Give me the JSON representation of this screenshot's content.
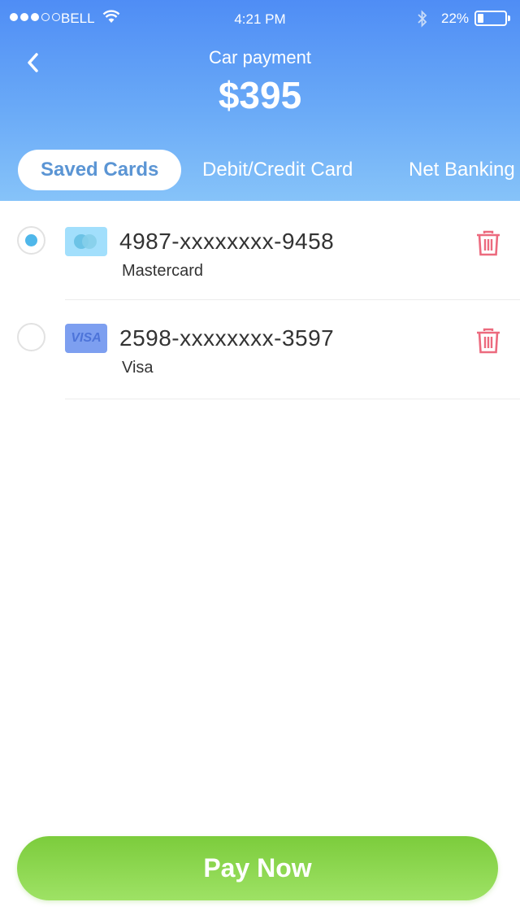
{
  "status_bar": {
    "carrier": "BELL",
    "time": "4:21 PM",
    "battery_percent": "22%",
    "battery_level": 0.22,
    "signal_bars_filled": 3,
    "signal_bars_total": 5
  },
  "header": {
    "title": "Car payment",
    "amount": "$395",
    "back_icon": "chevron-left-icon"
  },
  "tabs": [
    {
      "label": "Saved Cards",
      "active": true
    },
    {
      "label": "Debit/Credit Card",
      "active": false
    },
    {
      "label": "Net Banking",
      "active": false
    }
  ],
  "cards": [
    {
      "number": "4987-xxxxxxxx-9458",
      "type": "Mastercard",
      "brand_icon": "mastercard-icon",
      "selected": true
    },
    {
      "number": "2598-xxxxxxxx-3597",
      "type": "Visa",
      "brand_icon": "visa-icon",
      "brand_text": "VISA",
      "selected": false
    }
  ],
  "pay_button": {
    "label": "Pay Now"
  },
  "colors": {
    "header_top": "#4f8df5",
    "header_bottom": "#86c3f9",
    "accent_blue": "#4fb7ea",
    "delete_red": "#ec6a7e",
    "pay_green": "#7ccc3c"
  }
}
